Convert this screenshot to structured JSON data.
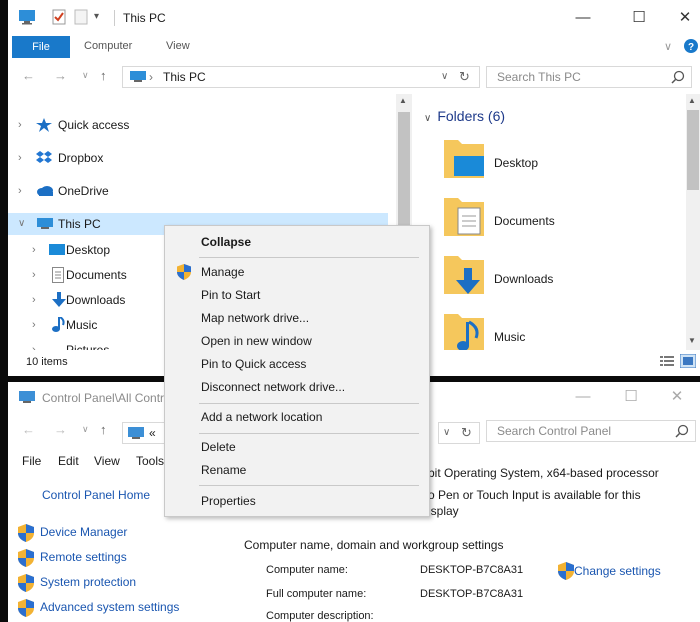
{
  "explorer": {
    "title": "This PC",
    "ribbon_tabs": {
      "file": "File",
      "computer": "Computer",
      "view": "View"
    },
    "address": {
      "crumb": "This PC"
    },
    "search_placeholder": "Search This PC",
    "nav_items": [
      {
        "label": "Quick access"
      },
      {
        "label": "Dropbox"
      },
      {
        "label": "OneDrive"
      },
      {
        "label": "This PC"
      },
      {
        "label": "Desktop"
      },
      {
        "label": "Documents"
      },
      {
        "label": "Downloads"
      },
      {
        "label": "Music"
      },
      {
        "label": "Pictures"
      }
    ],
    "status": "10 items",
    "folders_header": "Folders (6)",
    "folders": [
      {
        "label": "Desktop"
      },
      {
        "label": "Documents"
      },
      {
        "label": "Downloads"
      },
      {
        "label": "Music"
      }
    ]
  },
  "control_panel": {
    "title": "Control Panel\\All Control Panel Items\\System",
    "address_prefix": "«",
    "search_placeholder": "Search Control Panel",
    "menu": {
      "file": "File",
      "edit": "Edit",
      "view": "View",
      "tools": "Tools"
    },
    "home_link": "Control Panel Home",
    "side_links": [
      {
        "label": "Device Manager"
      },
      {
        "label": "Remote settings"
      },
      {
        "label": "System protection"
      },
      {
        "label": "Advanced system settings"
      }
    ],
    "system_type_partial": "bit Operating System, x64-based processor",
    "pen_partial": "o Pen or Touch Input is available for this",
    "display_partial": "isplay",
    "section_header": "Computer name, domain and workgroup settings",
    "fields": [
      {
        "key": "Computer name:",
        "value": "DESKTOP-B7C8A31"
      },
      {
        "key": "Full computer name:",
        "value": "DESKTOP-B7C8A31"
      },
      {
        "key": "Computer description:",
        "value": ""
      }
    ],
    "change_settings": "Change settings"
  },
  "context_menu": {
    "items": [
      {
        "label": "Collapse",
        "bold": true
      },
      {
        "label": "Manage",
        "shield": true
      },
      {
        "label": "Pin to Start"
      },
      {
        "label": "Map network drive..."
      },
      {
        "label": "Open in new window"
      },
      {
        "label": "Pin to Quick access"
      },
      {
        "label": "Disconnect network drive..."
      },
      {
        "label": "Add a network location"
      },
      {
        "label": "Delete"
      },
      {
        "label": "Rename"
      },
      {
        "label": "Properties"
      }
    ]
  },
  "colors": {
    "accent": "#1979ca",
    "link": "#1a56b0",
    "selection": "#cce8ff",
    "menu_bg": "#f2f2f2"
  }
}
